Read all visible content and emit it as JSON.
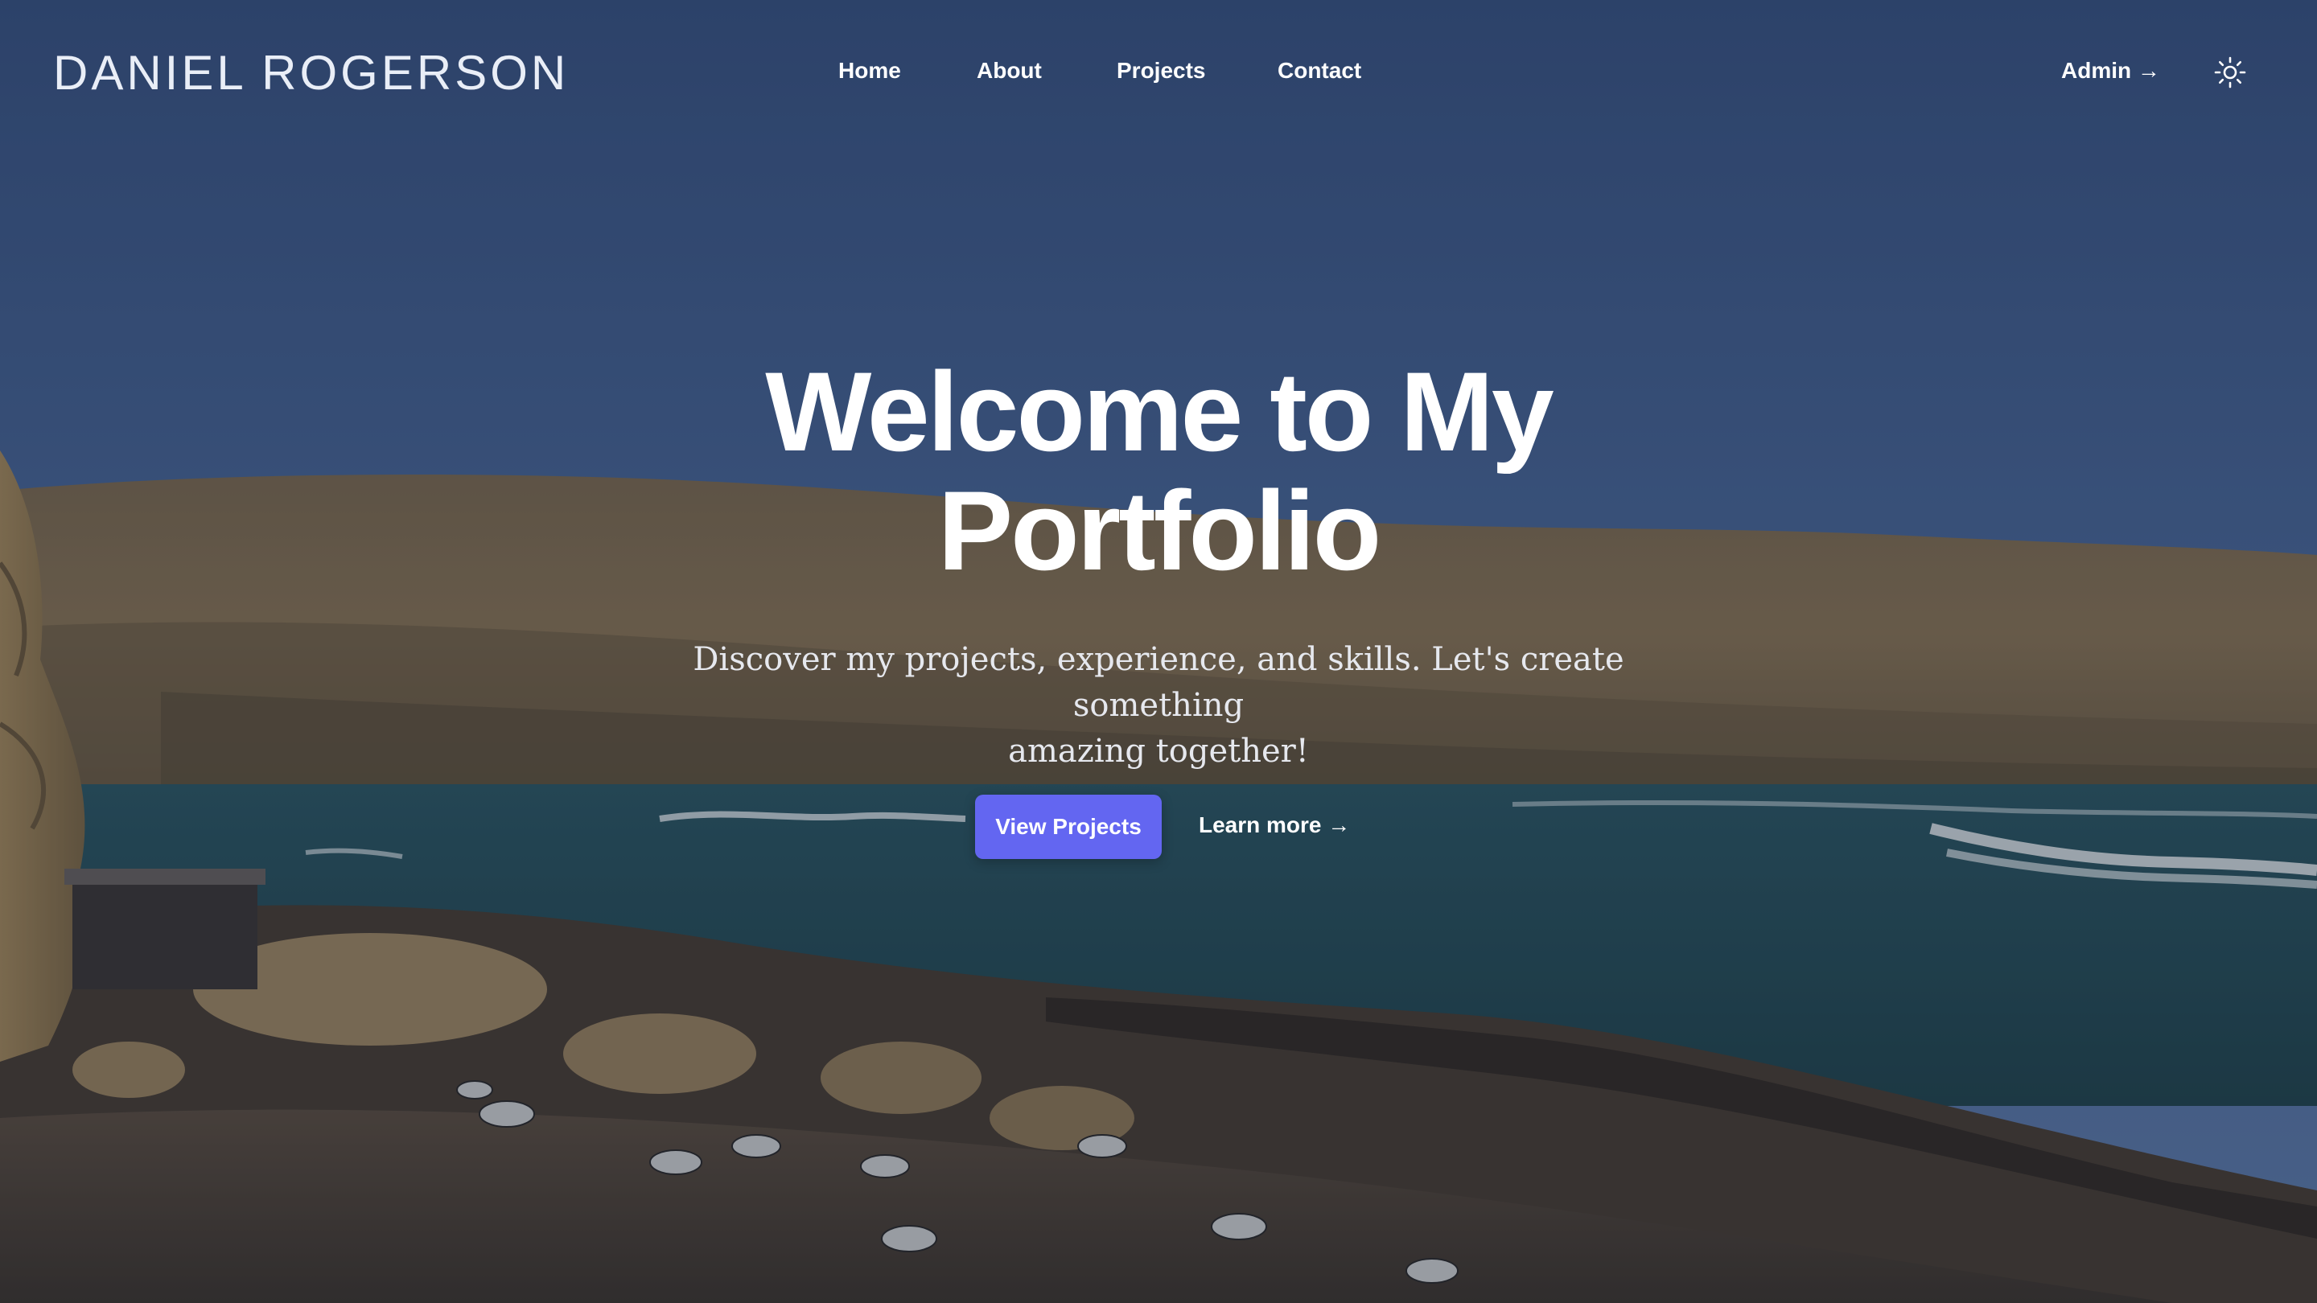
{
  "brand": {
    "name": "DANIEL ROGERSON"
  },
  "nav": {
    "items": [
      {
        "label": "Home"
      },
      {
        "label": "About"
      },
      {
        "label": "Projects"
      },
      {
        "label": "Contact"
      }
    ],
    "admin_label": "Admin →",
    "theme_icon": "sun-icon"
  },
  "hero": {
    "title_line1": "Welcome to My",
    "title_line2": "Portfolio",
    "subtitle_line1": "Discover my projects, experience, and skills. Let's create something",
    "subtitle_line2": "amazing together!",
    "primary_cta": "View Projects",
    "secondary_cta": "Learn more →",
    "background": "coastal-landscape-photo"
  },
  "colors": {
    "accent": "#6366f1",
    "text_primary": "#ffffff",
    "text_secondary": "#e6e8ee",
    "sky": "#3f5b8a"
  }
}
